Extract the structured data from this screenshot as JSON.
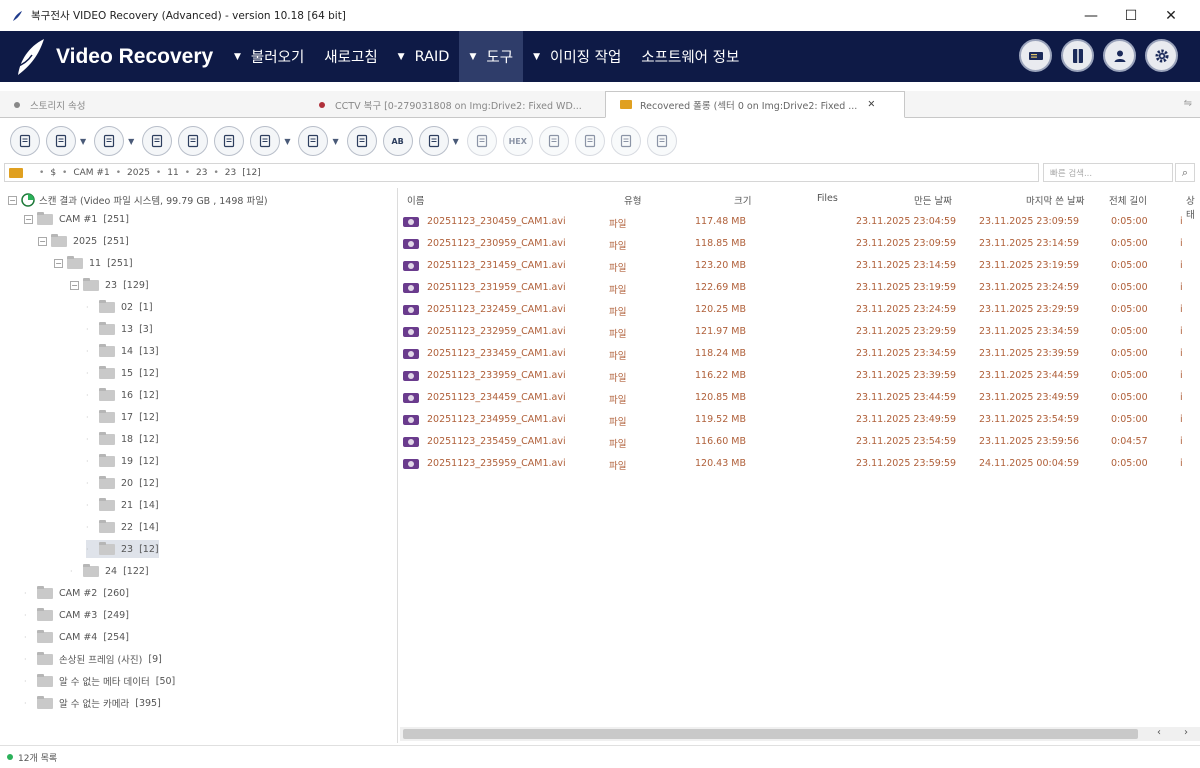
{
  "window": {
    "title": "복구전사 VIDEO Recovery (Advanced) - version 10.18 [64 bit]",
    "minimize": "—",
    "maximize": "☐",
    "close": "✕"
  },
  "nav": {
    "brand": "Video Recovery",
    "menu": [
      {
        "label": "불러오기",
        "has_arrow": true
      },
      {
        "label": "새로고침",
        "has_arrow": false
      },
      {
        "label": "RAID",
        "has_arrow": true
      },
      {
        "label": "도구",
        "has_arrow": true,
        "active": true
      },
      {
        "label": "이미징 작업",
        "has_arrow": true
      },
      {
        "label": "소프트웨어 정보",
        "has_arrow": false
      }
    ],
    "icons": [
      "drive-icon",
      "book-icon",
      "user-icon",
      "settings-gear-icon"
    ]
  },
  "tabs": [
    {
      "label": "스토리지 속성",
      "dot_color": "#888888"
    },
    {
      "label": "CCTV 복구 [0-279031808 on Img:Drive2: Fixed WD...",
      "dot_color": "#b0303a"
    },
    {
      "label": "Recovered 폴롱 (섹터 0 on Img:Drive2: Fixed ...",
      "dot_color": "#e0a020",
      "active": true,
      "close": "✕"
    }
  ],
  "toolbar": {
    "buttons": [
      {
        "icon": "file-properties-icon"
      },
      {
        "icon": "grid-view-icon",
        "dropdown": true
      },
      {
        "icon": "save-icon",
        "dropdown": true
      },
      {
        "icon": "export-icon"
      },
      {
        "icon": "wand-icon"
      },
      {
        "icon": "list-icon"
      },
      {
        "icon": "filter-icon",
        "dropdown": true
      },
      {
        "icon": "preview-icon",
        "dropdown": true
      },
      {
        "icon": "binoculars-icon"
      },
      {
        "icon": "ab-text-icon",
        "text": "AB"
      },
      {
        "icon": "tree-view-icon",
        "dropdown": true
      },
      {
        "icon": "document-icon",
        "dim": true
      },
      {
        "icon": "hex-icon",
        "text": "HEX",
        "dim": true
      },
      {
        "icon": "page-icon",
        "dim": true
      },
      {
        "icon": "copy-icon",
        "dim": true
      },
      {
        "icon": "merge-icon",
        "dim": true
      },
      {
        "icon": "split-icon",
        "dim": true
      }
    ]
  },
  "path": {
    "segments": [
      "$",
      "CAM #1",
      "2025",
      "11",
      "23",
      "23",
      "[12]"
    ],
    "search_placeholder": "빠른 검색..."
  },
  "tree": {
    "root": {
      "label": "스캔 결과 (Video 파일 시스템, 99.79 GB , 1498 파일)"
    },
    "nodes": [
      {
        "label": "CAM #1",
        "count": "[251]",
        "exp": "⊟"
      },
      {
        "label": "2025",
        "count": "[251]",
        "exp": "⊟"
      },
      {
        "label": "11",
        "count": "[251]",
        "exp": "⊟"
      },
      {
        "label": "23",
        "count": "[129]",
        "exp": "⊟"
      },
      {
        "label": "02",
        "count": "[1]"
      },
      {
        "label": "13",
        "count": "[3]"
      },
      {
        "label": "14",
        "count": "[13]"
      },
      {
        "label": "15",
        "count": "[12]"
      },
      {
        "label": "16",
        "count": "[12]"
      },
      {
        "label": "17",
        "count": "[12]"
      },
      {
        "label": "18",
        "count": "[12]"
      },
      {
        "label": "19",
        "count": "[12]"
      },
      {
        "label": "20",
        "count": "[12]"
      },
      {
        "label": "21",
        "count": "[14]"
      },
      {
        "label": "22",
        "count": "[14]"
      },
      {
        "label": "23",
        "count": "[12]",
        "selected": true
      },
      {
        "label": "24",
        "count": "[122]"
      },
      {
        "label": "CAM #2",
        "count": "[260]"
      },
      {
        "label": "CAM #3",
        "count": "[249]"
      },
      {
        "label": "CAM #4",
        "count": "[254]"
      },
      {
        "label": "손상된 프레임 (사진)",
        "count": "[9]"
      },
      {
        "label": "알 수 없는 메타 데이터",
        "count": "[50]"
      },
      {
        "label": "알 수 없는 카메라",
        "count": "[395]"
      }
    ]
  },
  "table": {
    "columns": [
      "이름",
      "유형",
      "크기",
      "Files",
      "만든 날짜",
      "마지막 쓴 날짜",
      "전체 길이",
      "상태"
    ],
    "rows": [
      {
        "name": "20251123_230459_CAM1.avi",
        "type": "파일",
        "size": "117.48 MB",
        "created": "23.11.2025 23:04:59",
        "modified": "23.11.2025 23:09:59",
        "duration": "0:05:00",
        "status": "i"
      },
      {
        "name": "20251123_230959_CAM1.avi",
        "type": "파일",
        "size": "118.85 MB",
        "created": "23.11.2025 23:09:59",
        "modified": "23.11.2025 23:14:59",
        "duration": "0:05:00",
        "status": "i"
      },
      {
        "name": "20251123_231459_CAM1.avi",
        "type": "파일",
        "size": "123.20 MB",
        "created": "23.11.2025 23:14:59",
        "modified": "23.11.2025 23:19:59",
        "duration": "0:05:00",
        "status": "i"
      },
      {
        "name": "20251123_231959_CAM1.avi",
        "type": "파일",
        "size": "122.69 MB",
        "created": "23.11.2025 23:19:59",
        "modified": "23.11.2025 23:24:59",
        "duration": "0:05:00",
        "status": "i"
      },
      {
        "name": "20251123_232459_CAM1.avi",
        "type": "파일",
        "size": "120.25 MB",
        "created": "23.11.2025 23:24:59",
        "modified": "23.11.2025 23:29:59",
        "duration": "0:05:00",
        "status": "i"
      },
      {
        "name": "20251123_232959_CAM1.avi",
        "type": "파일",
        "size": "121.97 MB",
        "created": "23.11.2025 23:29:59",
        "modified": "23.11.2025 23:34:59",
        "duration": "0:05:00",
        "status": "i"
      },
      {
        "name": "20251123_233459_CAM1.avi",
        "type": "파일",
        "size": "118.24 MB",
        "created": "23.11.2025 23:34:59",
        "modified": "23.11.2025 23:39:59",
        "duration": "0:05:00",
        "status": "i"
      },
      {
        "name": "20251123_233959_CAM1.avi",
        "type": "파일",
        "size": "116.22 MB",
        "created": "23.11.2025 23:39:59",
        "modified": "23.11.2025 23:44:59",
        "duration": "0:05:00",
        "status": "i"
      },
      {
        "name": "20251123_234459_CAM1.avi",
        "type": "파일",
        "size": "120.85 MB",
        "created": "23.11.2025 23:44:59",
        "modified": "23.11.2025 23:49:59",
        "duration": "0:05:00",
        "status": "i"
      },
      {
        "name": "20251123_234959_CAM1.avi",
        "type": "파일",
        "size": "119.52 MB",
        "created": "23.11.2025 23:49:59",
        "modified": "23.11.2025 23:54:59",
        "duration": "0:05:00",
        "status": "i"
      },
      {
        "name": "20251123_235459_CAM1.avi",
        "type": "파일",
        "size": "116.60 MB",
        "created": "23.11.2025 23:54:59",
        "modified": "23.11.2025 23:59:56",
        "duration": "0:04:57",
        "status": "i"
      },
      {
        "name": "20251123_235959_CAM1.avi",
        "type": "파일",
        "size": "120.43 MB",
        "created": "23.11.2025 23:59:59",
        "modified": "24.11.2025 00:04:59",
        "duration": "0:05:00",
        "status": "i"
      }
    ]
  },
  "scroll": {
    "left": "‹",
    "right": "›"
  },
  "status": {
    "text": "12개 목록"
  }
}
